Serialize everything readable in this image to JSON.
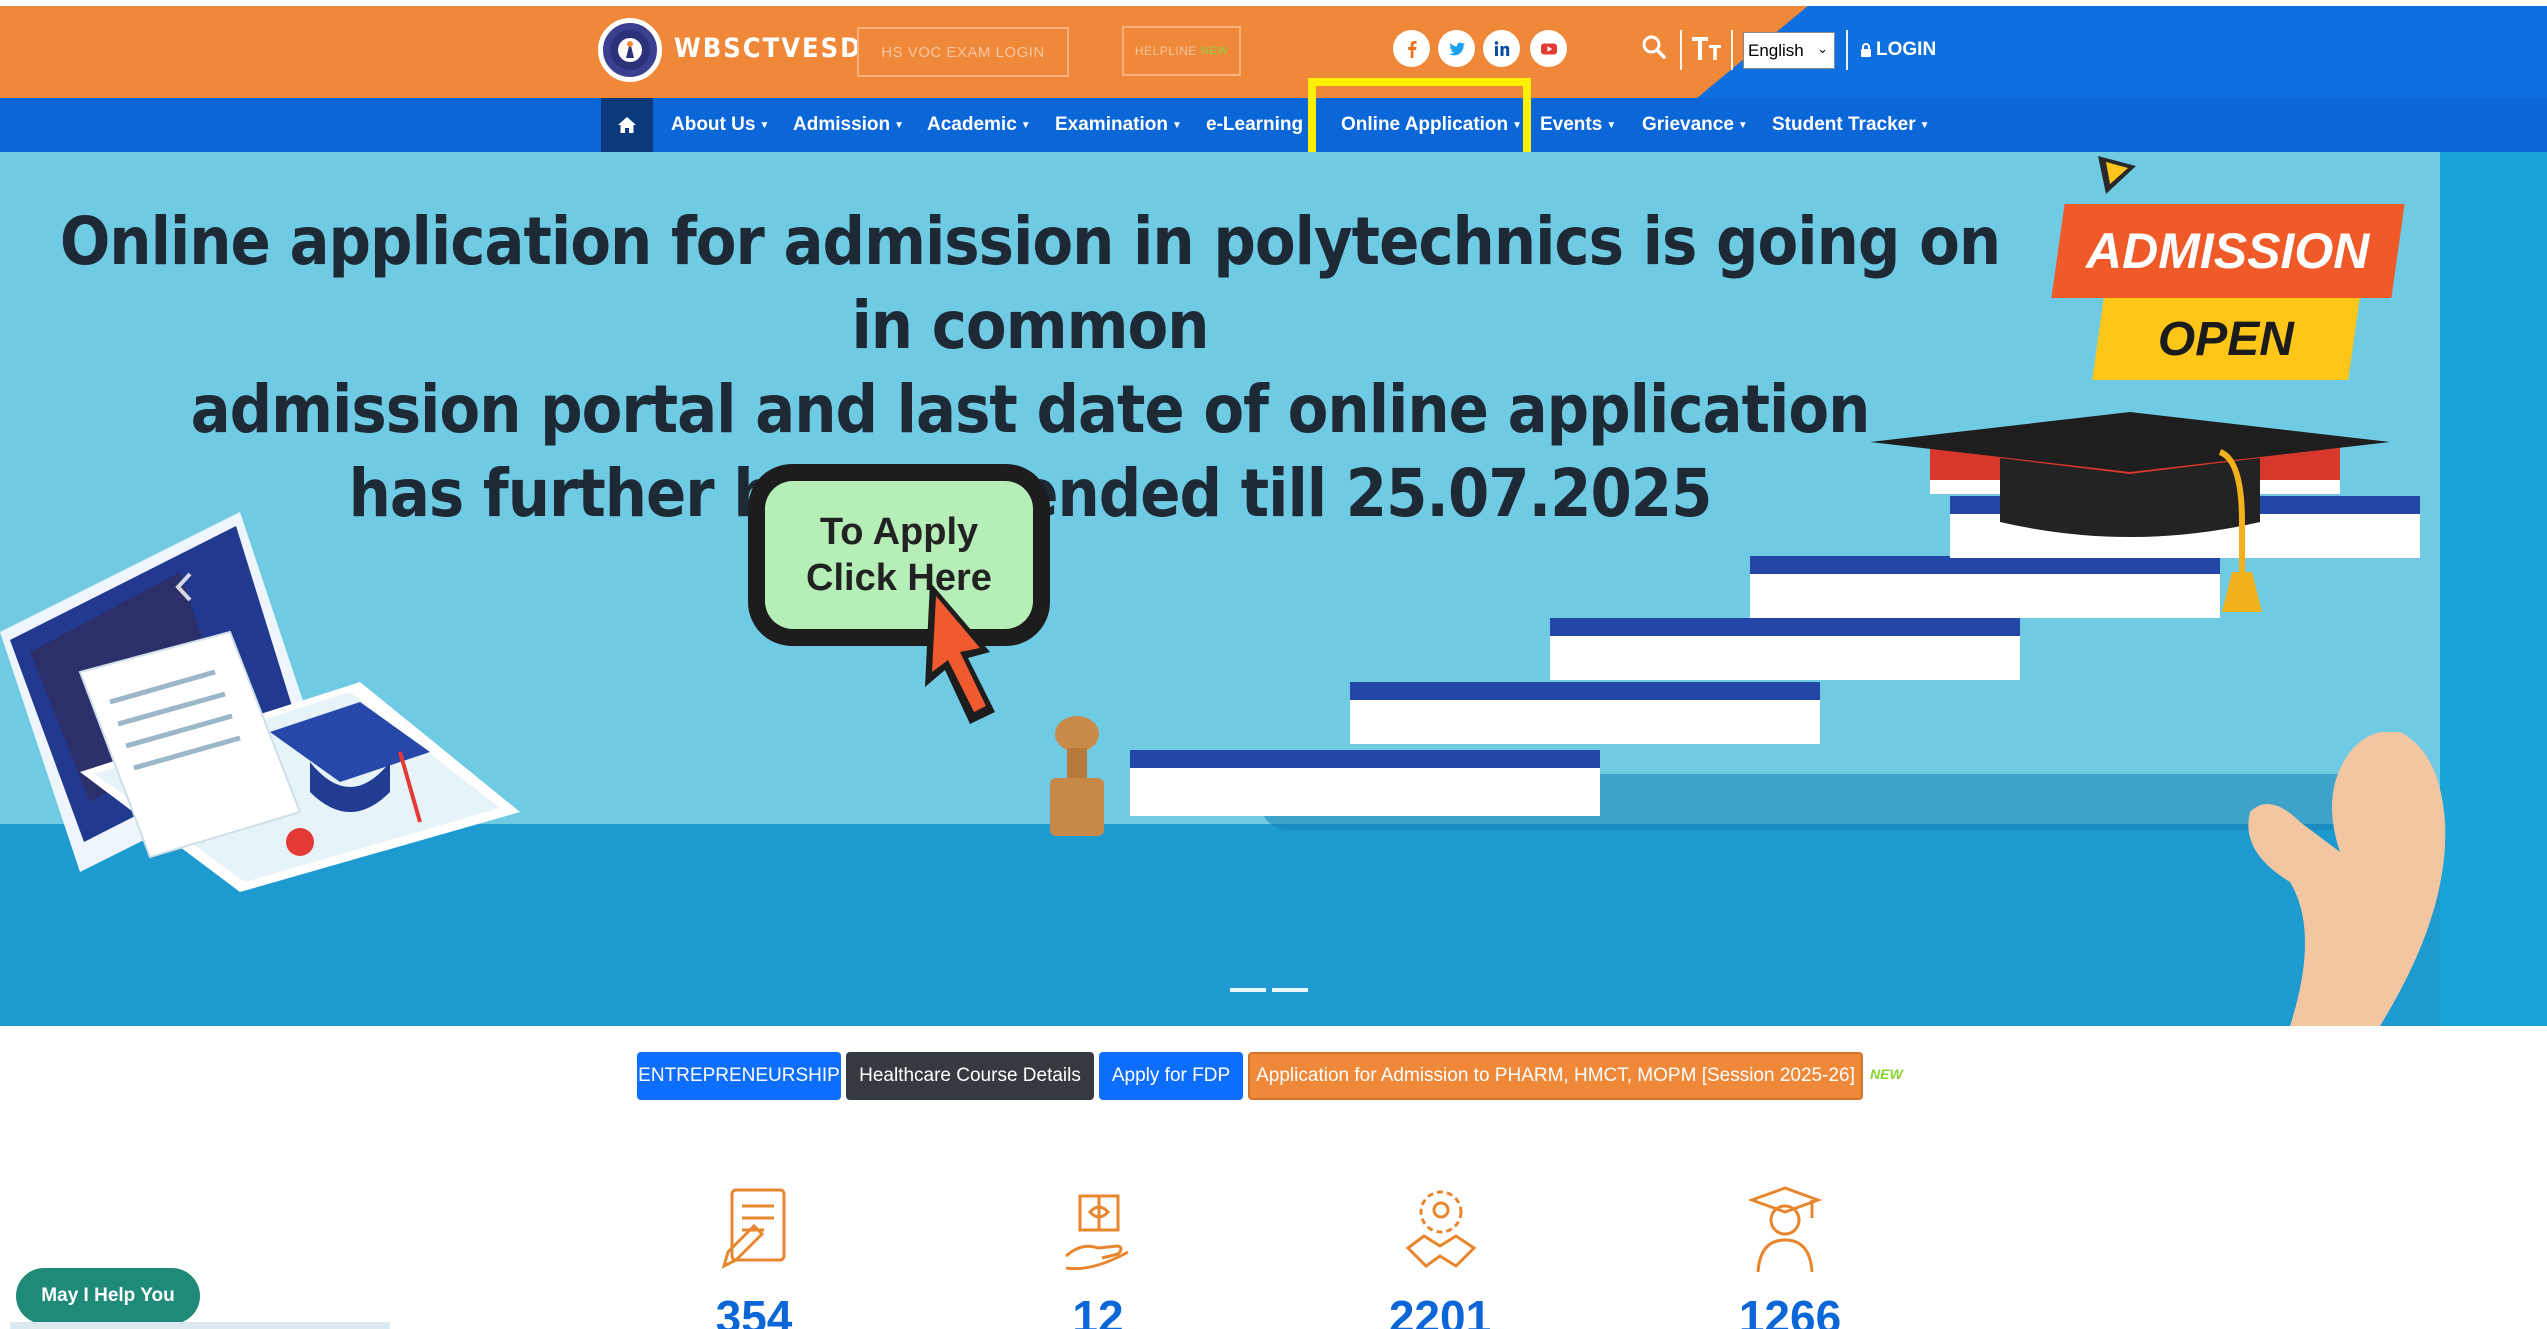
{
  "header": {
    "brand": "WBSCTVESD",
    "hs_voc_login": "HS VOC EXAM LOGIN",
    "helpline": "HELPLINE",
    "helpline_badge": "NEW",
    "language_selected": "English",
    "login": "LOGIN",
    "social_icons": [
      "facebook-icon",
      "twitter-icon",
      "linkedin-icon",
      "youtube-icon"
    ],
    "colors": {
      "orange": "#f0883a",
      "blue": "#0d6fe0"
    }
  },
  "nav": {
    "items": [
      "About Us",
      "Admission",
      "Academic",
      "Examination",
      "e-Learning",
      "Online Application",
      "Events",
      "Grievance",
      "Student Tracker"
    ],
    "highlighted": "Online Application",
    "highlight_color": "#ffef00"
  },
  "hero": {
    "headline_lines": [
      "Online application for admission in polytechnics is going on in common",
      "admission portal and last date of online application",
      "has further been extended till 25.07.2025"
    ],
    "apply_line1": "To Apply",
    "apply_line2": "Click Here",
    "badge_top": "ADMISSION",
    "badge_bottom": "OPEN",
    "slide_count": 2
  },
  "quick_links": {
    "entrepreneurship": "ENTREPRENEURSHIP",
    "healthcare": "Healthcare Course Details",
    "fdp": "Apply for FDP",
    "pharm": "Application for Admission to PHARM, HMCT, MOPM [Session 2025-26]",
    "new_badge": "NEW"
  },
  "stats": [
    {
      "icon": "document-edit-icon",
      "value": "354"
    },
    {
      "icon": "gift-hand-icon",
      "value": "12"
    },
    {
      "icon": "handshake-gear-icon",
      "value": "2201"
    },
    {
      "icon": "graduate-icon",
      "value": "1266"
    }
  ],
  "help": {
    "label": "May I Help You"
  }
}
